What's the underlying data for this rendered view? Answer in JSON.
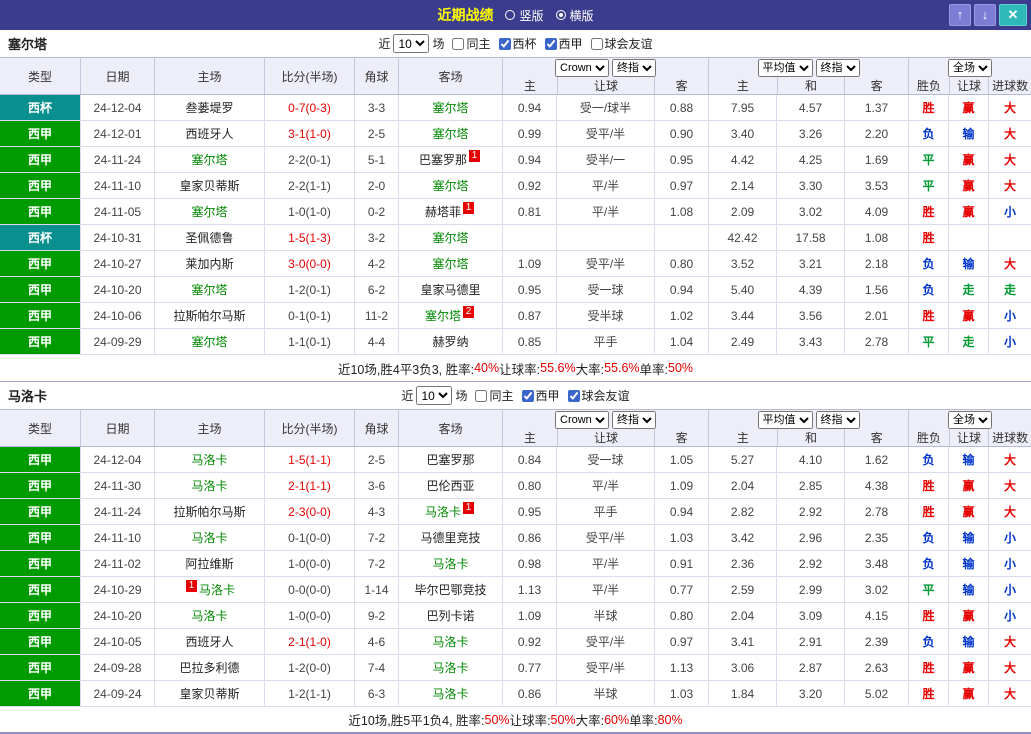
{
  "titlebar": {
    "title": "近期战绩",
    "layout_options": [
      {
        "label": "竖版",
        "selected": false
      },
      {
        "label": "横版",
        "selected": true
      }
    ],
    "up_button": "↑",
    "down_button": "↓",
    "close_button": "✕"
  },
  "filter_bar": {
    "near_label": "近",
    "count_value": "10",
    "matches_label": "场"
  },
  "header_controls": {
    "bookmaker": "Crown",
    "final_odds": "终指",
    "average": "平均值",
    "full_match": "全场"
  },
  "columns": [
    "类型",
    "日期",
    "主场",
    "比分(半场)",
    "角球",
    "客场",
    "主",
    "让球",
    "客",
    "主",
    "和",
    "客",
    "胜负",
    "让球",
    "进球数"
  ],
  "sections": [
    {
      "team": "塞尔塔",
      "filters": [
        {
          "label": "同主",
          "checked": false
        },
        {
          "label": "西杯",
          "checked": true
        },
        {
          "label": "西甲",
          "checked": true
        },
        {
          "label": "球会友谊",
          "checked": false
        }
      ],
      "rows": [
        {
          "type": "西杯",
          "date": "24-12-04",
          "home": {
            "name": "叁蒌堤罗"
          },
          "score": "0-7(0-3)",
          "score_red": true,
          "corners": "3-3",
          "away": {
            "name": "塞尔塔",
            "highlight": true
          },
          "odds": [
            "0.94",
            "受一/球半",
            "0.88"
          ],
          "avg": [
            "7.95",
            "4.57",
            "1.37"
          ],
          "results": [
            "胜",
            "赢",
            "大"
          ]
        },
        {
          "type": "西甲",
          "date": "24-12-01",
          "home": {
            "name": "西班牙人"
          },
          "score": "3-1(1-0)",
          "score_red": true,
          "corners": "2-5",
          "away": {
            "name": "塞尔塔",
            "highlight": true
          },
          "odds": [
            "0.99",
            "受平/半",
            "0.90"
          ],
          "avg": [
            "3.40",
            "3.26",
            "2.20"
          ],
          "results": [
            "负",
            "输",
            "大"
          ]
        },
        {
          "type": "西甲",
          "date": "24-11-24",
          "home": {
            "name": "塞尔塔",
            "highlight": true
          },
          "score": "2-2(0-1)",
          "score_red": false,
          "corners": "5-1",
          "away": {
            "name": "巴塞罗那",
            "badge": "1"
          },
          "odds": [
            "0.94",
            "受半/一",
            "0.95"
          ],
          "avg": [
            "4.42",
            "4.25",
            "1.69"
          ],
          "results": [
            "平",
            "赢",
            "大"
          ]
        },
        {
          "type": "西甲",
          "date": "24-11-10",
          "home": {
            "name": "皇家贝蒂斯"
          },
          "score": "2-2(1-1)",
          "score_red": false,
          "corners": "2-0",
          "away": {
            "name": "塞尔塔",
            "highlight": true
          },
          "odds": [
            "0.92",
            "平/半",
            "0.97"
          ],
          "avg": [
            "2.14",
            "3.30",
            "3.53"
          ],
          "results": [
            "平",
            "赢",
            "大"
          ]
        },
        {
          "type": "西甲",
          "date": "24-11-05",
          "home": {
            "name": "塞尔塔",
            "highlight": true
          },
          "score": "1-0(1-0)",
          "score_red": false,
          "corners": "0-2",
          "away": {
            "name": "赫塔菲",
            "badge": "1"
          },
          "odds": [
            "0.81",
            "平/半",
            "1.08"
          ],
          "avg": [
            "2.09",
            "3.02",
            "4.09"
          ],
          "results": [
            "胜",
            "赢",
            "小"
          ]
        },
        {
          "type": "西杯",
          "date": "24-10-31",
          "home": {
            "name": "圣佩德鲁"
          },
          "score": "1-5(1-3)",
          "score_red": true,
          "corners": "3-2",
          "away": {
            "name": "塞尔塔",
            "highlight": true
          },
          "odds": [
            "",
            "",
            ""
          ],
          "avg": [
            "42.42",
            "17.58",
            "1.08"
          ],
          "results": [
            "胜",
            "",
            ""
          ]
        },
        {
          "type": "西甲",
          "date": "24-10-27",
          "home": {
            "name": "莱加内斯"
          },
          "score": "3-0(0-0)",
          "score_red": true,
          "corners": "4-2",
          "away": {
            "name": "塞尔塔",
            "highlight": true
          },
          "odds": [
            "1.09",
            "受平/半",
            "0.80"
          ],
          "avg": [
            "3.52",
            "3.21",
            "2.18"
          ],
          "results": [
            "负",
            "输",
            "大"
          ]
        },
        {
          "type": "西甲",
          "date": "24-10-20",
          "home": {
            "name": "塞尔塔",
            "highlight": true
          },
          "score": "1-2(0-1)",
          "score_red": false,
          "corners": "6-2",
          "away": {
            "name": "皇家马德里"
          },
          "odds": [
            "0.95",
            "受一球",
            "0.94"
          ],
          "avg": [
            "5.40",
            "4.39",
            "1.56"
          ],
          "results": [
            "负",
            "走",
            "走"
          ]
        },
        {
          "type": "西甲",
          "date": "24-10-06",
          "home": {
            "name": "拉斯帕尔马斯"
          },
          "score": "0-1(0-1)",
          "score_red": false,
          "corners": "11-2",
          "away": {
            "name": "塞尔塔",
            "highlight": true,
            "badge": "2"
          },
          "odds": [
            "0.87",
            "受半球",
            "1.02"
          ],
          "avg": [
            "3.44",
            "3.56",
            "2.01"
          ],
          "results": [
            "胜",
            "赢",
            "小"
          ]
        },
        {
          "type": "西甲",
          "date": "24-09-29",
          "home": {
            "name": "塞尔塔",
            "highlight": true
          },
          "score": "1-1(0-1)",
          "score_red": false,
          "corners": "4-4",
          "away": {
            "name": "赫罗纳"
          },
          "odds": [
            "0.85",
            "平手",
            "1.04"
          ],
          "avg": [
            "2.49",
            "3.43",
            "2.78"
          ],
          "results": [
            "平",
            "走",
            "小"
          ]
        }
      ],
      "summary": [
        {
          "text": "近10场,胜4平3负3, 胜率:",
          "red": false
        },
        {
          "text": "40%",
          "red": true
        },
        {
          "text": " 让球率:",
          "red": false
        },
        {
          "text": "55.6%",
          "red": true
        },
        {
          "text": " 大率:",
          "red": false
        },
        {
          "text": "55.6%",
          "red": true
        },
        {
          "text": " 单率:",
          "red": false
        },
        {
          "text": "50%",
          "red": true
        }
      ]
    },
    {
      "team": "马洛卡",
      "filters": [
        {
          "label": "同主",
          "checked": false
        },
        {
          "label": "西甲",
          "checked": true
        },
        {
          "label": "球会友谊",
          "checked": true
        }
      ],
      "rows": [
        {
          "type": "西甲",
          "date": "24-12-04",
          "home": {
            "name": "马洛卡",
            "highlight": true
          },
          "score": "1-5(1-1)",
          "score_red": true,
          "corners": "2-5",
          "away": {
            "name": "巴塞罗那"
          },
          "odds": [
            "0.84",
            "受一球",
            "1.05"
          ],
          "avg": [
            "5.27",
            "4.10",
            "1.62"
          ],
          "results": [
            "负",
            "输",
            "大"
          ]
        },
        {
          "type": "西甲",
          "date": "24-11-30",
          "home": {
            "name": "马洛卡",
            "highlight": true
          },
          "score": "2-1(1-1)",
          "score_red": true,
          "corners": "3-6",
          "away": {
            "name": "巴伦西亚"
          },
          "odds": [
            "0.80",
            "平/半",
            "1.09"
          ],
          "avg": [
            "2.04",
            "2.85",
            "4.38"
          ],
          "results": [
            "胜",
            "赢",
            "大"
          ]
        },
        {
          "type": "西甲",
          "date": "24-11-24",
          "home": {
            "name": "拉斯帕尔马斯"
          },
          "score": "2-3(0-0)",
          "score_red": true,
          "corners": "4-3",
          "away": {
            "name": "马洛卡",
            "highlight": true,
            "badge": "1"
          },
          "odds": [
            "0.95",
            "平手",
            "0.94"
          ],
          "avg": [
            "2.82",
            "2.92",
            "2.78"
          ],
          "results": [
            "胜",
            "赢",
            "大"
          ]
        },
        {
          "type": "西甲",
          "date": "24-11-10",
          "home": {
            "name": "马洛卡",
            "highlight": true
          },
          "score": "0-1(0-0)",
          "score_red": false,
          "corners": "7-2",
          "away": {
            "name": "马德里竞技"
          },
          "odds": [
            "0.86",
            "受平/半",
            "1.03"
          ],
          "avg": [
            "3.42",
            "2.96",
            "2.35"
          ],
          "results": [
            "负",
            "输",
            "小"
          ]
        },
        {
          "type": "西甲",
          "date": "24-11-02",
          "home": {
            "name": "阿拉维斯"
          },
          "score": "1-0(0-0)",
          "score_red": false,
          "corners": "7-2",
          "away": {
            "name": "马洛卡",
            "highlight": true
          },
          "odds": [
            "0.98",
            "平/半",
            "0.91"
          ],
          "avg": [
            "2.36",
            "2.92",
            "3.48"
          ],
          "results": [
            "负",
            "输",
            "小"
          ]
        },
        {
          "type": "西甲",
          "date": "24-10-29",
          "home": {
            "name": "马洛卡",
            "highlight": true,
            "badge": "1",
            "badge_before": true
          },
          "score": "0-0(0-0)",
          "score_red": false,
          "corners": "1-14",
          "away": {
            "name": "毕尔巴鄂竞技"
          },
          "odds": [
            "1.13",
            "平/半",
            "0.77"
          ],
          "avg": [
            "2.59",
            "2.99",
            "3.02"
          ],
          "results": [
            "平",
            "输",
            "小"
          ]
        },
        {
          "type": "西甲",
          "date": "24-10-20",
          "home": {
            "name": "马洛卡",
            "highlight": true
          },
          "score": "1-0(0-0)",
          "score_red": false,
          "corners": "9-2",
          "away": {
            "name": "巴列卡诺"
          },
          "odds": [
            "1.09",
            "半球",
            "0.80"
          ],
          "avg": [
            "2.04",
            "3.09",
            "4.15"
          ],
          "results": [
            "胜",
            "赢",
            "小"
          ]
        },
        {
          "type": "西甲",
          "date": "24-10-05",
          "home": {
            "name": "西班牙人"
          },
          "score": "2-1(1-0)",
          "score_red": true,
          "corners": "4-6",
          "away": {
            "name": "马洛卡",
            "highlight": true
          },
          "odds": [
            "0.92",
            "受平/半",
            "0.97"
          ],
          "avg": [
            "3.41",
            "2.91",
            "2.39"
          ],
          "results": [
            "负",
            "输",
            "大"
          ]
        },
        {
          "type": "西甲",
          "date": "24-09-28",
          "home": {
            "name": "巴拉多利德"
          },
          "score": "1-2(0-0)",
          "score_red": false,
          "corners": "7-4",
          "away": {
            "name": "马洛卡",
            "highlight": true
          },
          "odds": [
            "0.77",
            "受平/半",
            "1.13"
          ],
          "avg": [
            "3.06",
            "2.87",
            "2.63"
          ],
          "results": [
            "胜",
            "赢",
            "大"
          ]
        },
        {
          "type": "西甲",
          "date": "24-09-24",
          "home": {
            "name": "皇家贝蒂斯"
          },
          "score": "1-2(1-1)",
          "score_red": false,
          "corners": "6-3",
          "away": {
            "name": "马洛卡",
            "highlight": true
          },
          "odds": [
            "0.86",
            "半球",
            "1.03"
          ],
          "avg": [
            "1.84",
            "3.20",
            "5.02"
          ],
          "results": [
            "胜",
            "赢",
            "大"
          ]
        }
      ],
      "summary": [
        {
          "text": "近10场,胜5平1负4, 胜率:",
          "red": false
        },
        {
          "text": "50%",
          "red": true
        },
        {
          "text": " 让球率:",
          "red": false
        },
        {
          "text": "50%",
          "red": true
        },
        {
          "text": " 大率:",
          "red": false
        },
        {
          "text": "60%",
          "red": true
        },
        {
          "text": " 单率:",
          "red": false
        },
        {
          "text": "80%",
          "red": true
        }
      ]
    }
  ]
}
